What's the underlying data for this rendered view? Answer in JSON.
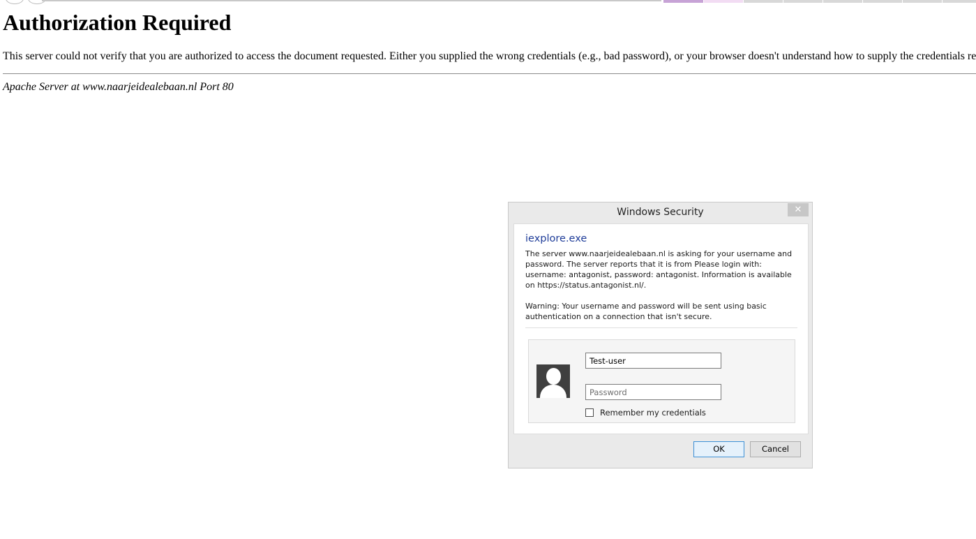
{
  "page": {
    "title": "Authorization Required",
    "message": "This server could not verify that you are authorized to access the document requested. Either you supplied the wrong credentials (e.g., bad password), or your browser doesn't understand how to supply the credentials re",
    "address": "Apache Server at www.naarjeidealebaan.nl Port 80"
  },
  "dialog": {
    "title": "Windows Security",
    "close_icon": "close-icon",
    "close_glyph": "✕",
    "app_name": "iexplore.exe",
    "server_message": "The server www.naarjeidealebaan.nl is asking for your username and password. The server reports that it is from Please login with: username: antagonist, password: antagonist. Information is available on https://status.antagonist.nl/.",
    "warning": "Warning: Your username and password will be sent using basic authentication on a connection that isn't secure.",
    "user_icon": "user-avatar-icon",
    "username_value": "Test-user",
    "password_placeholder": "Password",
    "remember_label": "Remember my credentials",
    "remember_checked": false,
    "ok_label": "OK",
    "cancel_label": "Cancel"
  },
  "colors": {
    "link_blue": "#1f3d99",
    "ok_border": "#3c8fd6",
    "close_button": "#c7c7c7"
  }
}
